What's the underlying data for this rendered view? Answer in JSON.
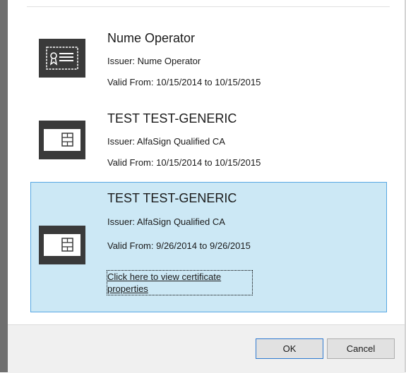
{
  "certificates": [
    {
      "name": "Nume Operator",
      "issuer": "Issuer: Nume Operator",
      "validity": "Valid From: 10/15/2014 to 10/15/2015",
      "icon": "certificate-badge-icon"
    },
    {
      "name": "TEST TEST-GENERIC",
      "issuer": "Issuer: AlfaSign Qualified CA",
      "validity": "Valid From: 10/15/2014 to 10/15/2015",
      "icon": "smart-card-icon"
    },
    {
      "name": "TEST TEST-GENERIC",
      "issuer": "Issuer: AlfaSign Qualified CA",
      "validity": "Valid From: 9/26/2014 to 9/26/2015",
      "icon": "smart-card-icon",
      "link": "Click here to view certificate properties"
    }
  ],
  "buttons": {
    "ok": "OK",
    "cancel": "Cancel"
  },
  "colors": {
    "selection_bg": "#cce8f5",
    "selection_border": "#56a7e3",
    "icon_bg": "#3a3a3a",
    "footer_bg": "#f0f0f0"
  }
}
